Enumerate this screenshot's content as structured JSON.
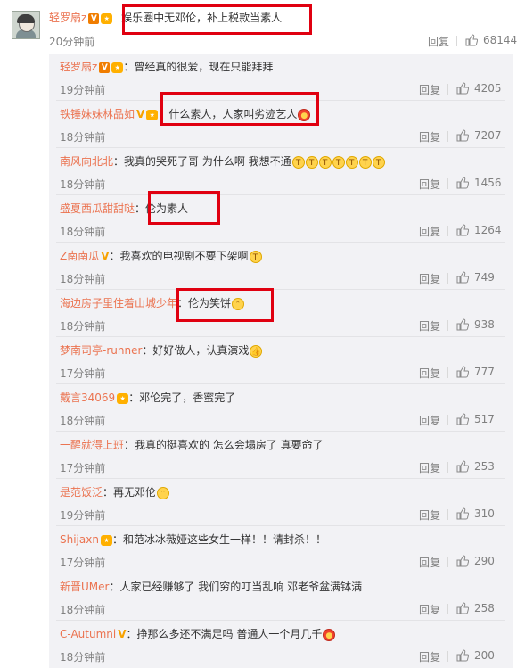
{
  "main": {
    "username": "轻罗扇z",
    "text": "娱乐圈中无邓伦，补上税款当素人",
    "time": "20分钟前",
    "reply": "回复",
    "likes": "68144"
  },
  "replies": [
    {
      "user": "轻罗扇z",
      "text": "：曾经真的很爱，现在只能拜拜",
      "time": "19分钟前",
      "reply": "回复",
      "likes": "4205"
    },
    {
      "user": "铁锤妹妹林品如",
      "text": "：什么素人，人家叫劣迹艺人",
      "time": "18分钟前",
      "reply": "回复",
      "likes": "7207"
    },
    {
      "user": "南风向北北",
      "text": "：我真的哭死了哥 为什么啊 我想不通",
      "time": "18分钟前",
      "reply": "回复",
      "likes": "1456"
    },
    {
      "user": "盛夏西瓜甜甜哒",
      "text": "：伦为素人",
      "time": "18分钟前",
      "reply": "回复",
      "likes": "1264"
    },
    {
      "user": "Z南南瓜",
      "text": "：我喜欢的电视剧不要下架啊",
      "time": "18分钟前",
      "reply": "回复",
      "likes": "749"
    },
    {
      "user": "海边房子里住着山城少年",
      "text": "：伦为笑饼",
      "time": "18分钟前",
      "reply": "回复",
      "likes": "938"
    },
    {
      "user": "梦南司亭-runner",
      "text": "：好好做人，认真演戏",
      "time": "17分钟前",
      "reply": "回复",
      "likes": "777"
    },
    {
      "user": "戴言34069",
      "text": "：邓伦完了，香蜜完了",
      "time": "18分钟前",
      "reply": "回复",
      "likes": "517"
    },
    {
      "user": "一醒就得上班",
      "text": "：我真的挺喜欢的 怎么会塌房了 真要命了",
      "time": "17分钟前",
      "reply": "回复",
      "likes": "253"
    },
    {
      "user": "是范饭泛",
      "text": "：再无邓伦",
      "time": "19分钟前",
      "reply": "回复",
      "likes": "310"
    },
    {
      "user": "Shijaxn",
      "text": "：和范冰冰薇娅这些女生一样！！请封杀！！",
      "time": "17分钟前",
      "reply": "回复",
      "likes": "290"
    },
    {
      "user": "新晋UMer",
      "text": "：人家已经赚够了 我们穷的叮当乱响 邓老爷盆满钵满",
      "time": "18分钟前",
      "reply": "回复",
      "likes": "258"
    },
    {
      "user": "C-Autumni",
      "text": "：挣那么多还不满足吗 普通人一个月几千",
      "time": "18分钟前",
      "reply": "回复",
      "likes": "200"
    }
  ]
}
